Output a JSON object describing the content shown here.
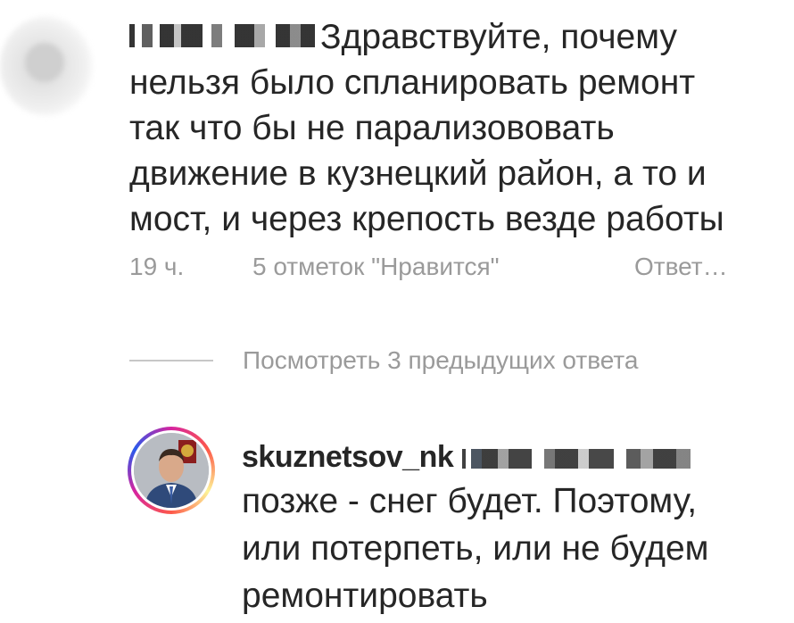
{
  "comment": {
    "text_lines": [
      "Здравствуйте, почему",
      "нельзя было спланировать ремонт",
      "так что бы не парализововать",
      "движение в кузнецкий район, а то и",
      "мост, и через крепость везде работы"
    ],
    "time": "19 ч.",
    "likes": "5 отметок \"Нравится\"",
    "reply_label": "Ответ…"
  },
  "view_previous": "Посмотреть 3 предыдущих ответа",
  "reply": {
    "username": "skuznetsov_nk",
    "text_lines": [
      "позже - снег будет. Поэтому,",
      "или потерпеть, или не будем",
      "ремонтировать"
    ]
  }
}
